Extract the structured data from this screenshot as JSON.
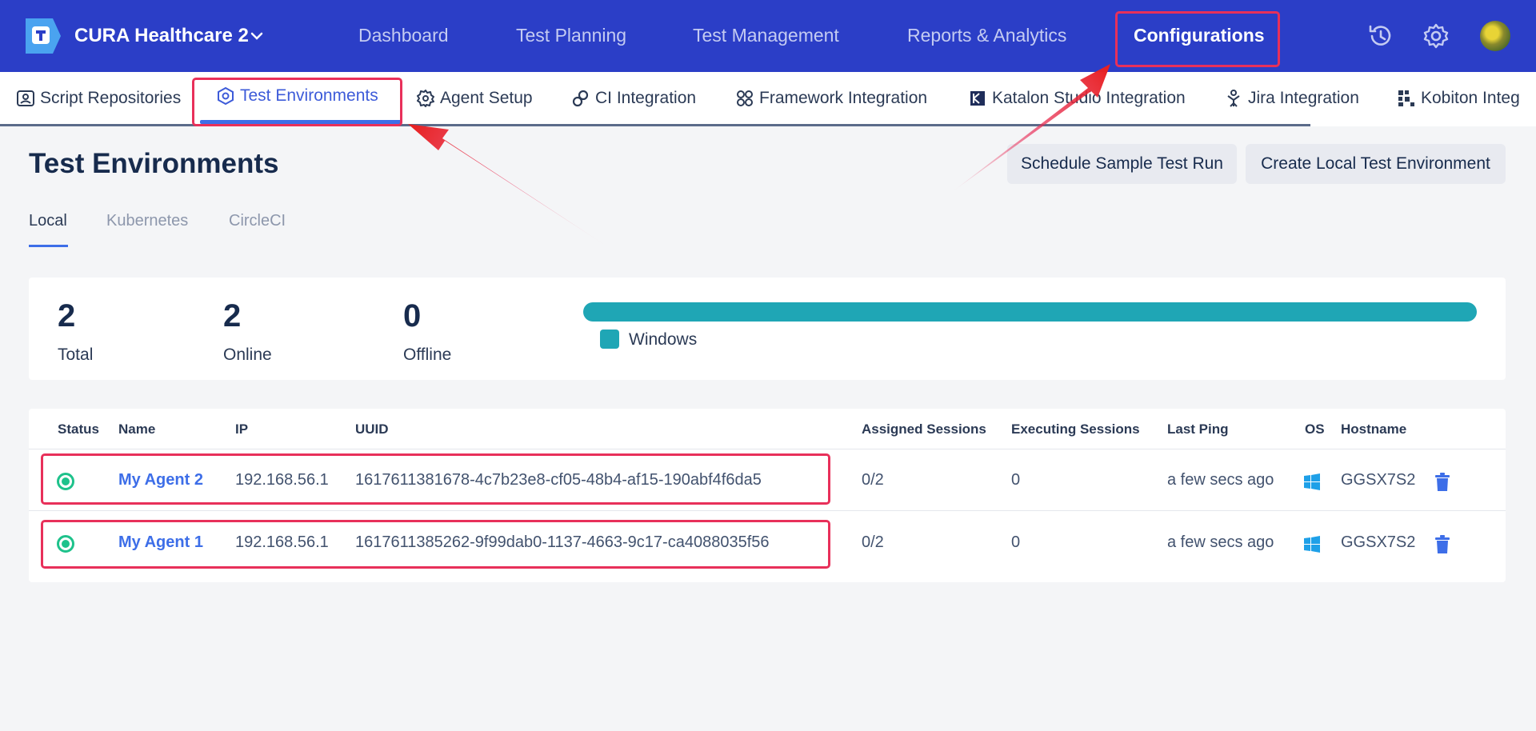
{
  "app": {
    "project_name": "CURA Healthcare 2"
  },
  "top_nav": [
    "Dashboard",
    "Test Planning",
    "Test Management",
    "Reports & Analytics",
    "Configurations"
  ],
  "sub_nav": [
    "Script Repositories",
    "Test Environments",
    "Agent Setup",
    "CI Integration",
    "Framework Integration",
    "Katalon Studio Integration",
    "Jira Integration",
    "Kobiton Integ"
  ],
  "page": {
    "title": "Test Environments",
    "buttons": [
      "Schedule Sample Test Run",
      "Create Local Test Environment"
    ],
    "tabs": [
      "Local",
      "Kubernetes",
      "CircleCI"
    ],
    "active_tab": "Local"
  },
  "stats": [
    {
      "value": "2",
      "label": "Total"
    },
    {
      "value": "2",
      "label": "Online"
    },
    {
      "value": "0",
      "label": "Offline"
    }
  ],
  "os_distribution": {
    "legend": "Windows",
    "fraction": 1.0,
    "color": "#1fa6b5"
  },
  "table": {
    "headers": [
      "Status",
      "Name",
      "IP",
      "UUID",
      "Assigned Sessions",
      "Executing Sessions",
      "Last Ping",
      "OS",
      "Hostname"
    ],
    "rows": [
      {
        "status": "online",
        "name": "My Agent 2",
        "ip": "192.168.56.1",
        "uuid": "1617611381678-4c7b23e8-cf05-48b4-af15-190abf4f6da5",
        "assigned": "0/2",
        "executing": "0",
        "last_ping": "a few secs ago",
        "os": "windows-icon",
        "hostname": "GGSX7S2"
      },
      {
        "status": "online",
        "name": "My Agent 1",
        "ip": "192.168.56.1",
        "uuid": "1617611385262-9f99dab0-1137-4663-9c17-ca4088035f56",
        "assigned": "0/2",
        "executing": "0",
        "last_ping": "a few secs ago",
        "os": "windows-icon",
        "hostname": "GGSX7S2"
      }
    ]
  },
  "colors": {
    "header_bg": "#2b3ec7",
    "accent": "#3d6ee8",
    "online": "#1ec28b",
    "annotation": "#e8305a"
  }
}
